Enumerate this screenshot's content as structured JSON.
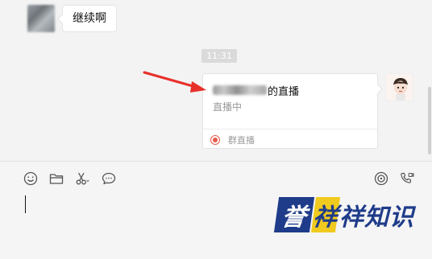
{
  "messages": {
    "incoming_text": "继续啊",
    "timestamp": "11:31",
    "live_card": {
      "title_suffix": "的直播",
      "status": "直播中",
      "footer_label": "群直播"
    }
  },
  "composer": {
    "toolbar_icons": [
      "emoji-icon",
      "folder-icon",
      "scissors-icon",
      "chat-bubble-icon",
      "live-stream-icon",
      "video-call-icon"
    ]
  },
  "watermark": {
    "box1": "誉",
    "box2": "祥",
    "rest": "祥知识"
  },
  "colors": {
    "live_red": "#e65a4b",
    "annotation_arrow": "#e8302a",
    "watermark_blue": "#1f3c8a",
    "watermark_yellow": "#f0ca1e"
  }
}
